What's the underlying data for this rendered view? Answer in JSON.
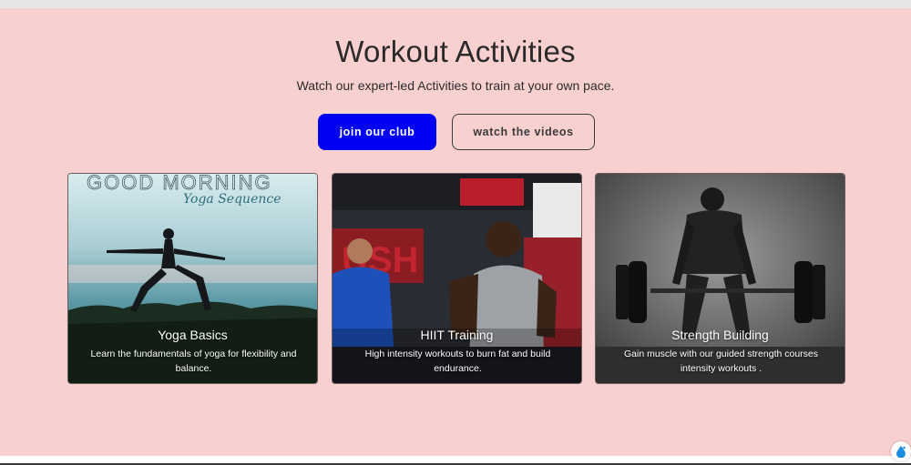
{
  "section": {
    "title": "Workout Activities",
    "subtitle": "Watch our expert-led Activities to train at your own pace.",
    "primary_button": "join our club",
    "secondary_button": "watch the videos"
  },
  "cards": [
    {
      "title": "Yoga Basics",
      "description": "Learn the fundamentals of yoga for flexibility and balance.",
      "image_text_1": "GOOD MORNING",
      "image_text_2": "Yoga Sequence"
    },
    {
      "title": "HIIT Training",
      "description": "High intensity workouts to burn fat and build endurance.",
      "image_text_1": "USH"
    },
    {
      "title": "Strength Building",
      "description": "Gain muscle with our guided strength courses intensity workouts ."
    }
  ],
  "colors": {
    "background": "#f9d0d0",
    "primary": "#0000f5"
  }
}
